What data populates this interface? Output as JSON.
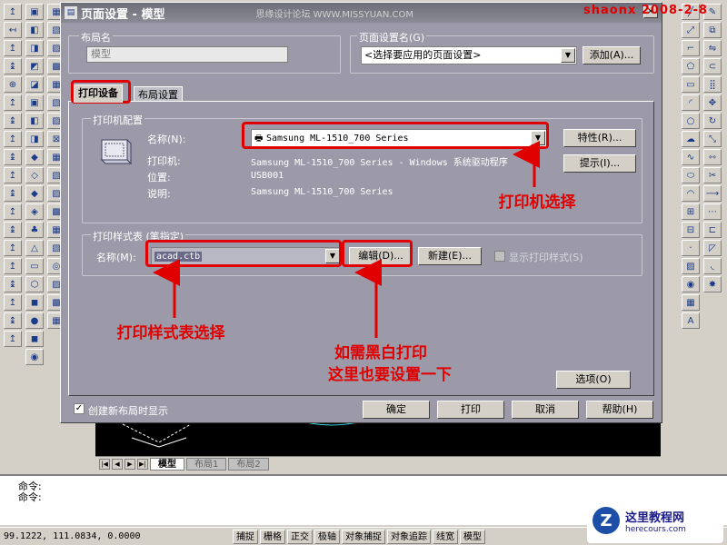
{
  "dialog": {
    "title": "页面设置 - 模型",
    "site_watermark": "思缘设计论坛 WWW.MISSYUAN.COM",
    "close_glyph": "×"
  },
  "stamp": "shaonx 2008-2-8",
  "layout_name": {
    "label": "布局名",
    "value": "模型"
  },
  "page_setup_name": {
    "label": "页面设置名(G)",
    "value": "<选择要应用的页面设置>",
    "add_button": "添加(A)..."
  },
  "tabs": [
    {
      "label": "打印设备"
    },
    {
      "label": "布局设置"
    }
  ],
  "printer_config": {
    "group_label": "打印机配置",
    "name_label": "名称(N):",
    "name_value": "Samsung ML-1510_700 Series",
    "properties_button": "特性(R)...",
    "hints_button": "提示(I)...",
    "printer_label": "打印机:",
    "printer_value": "Samsung ML-1510_700 Series - Windows 系统驱动程序",
    "location_label": "位置:",
    "location_value": "USB001",
    "description_label": "说明:",
    "description_value": "Samsung ML-1510_700 Series"
  },
  "plot_style": {
    "group_label": "打印样式表 (笔指定)",
    "name_label": "名称(M):",
    "name_value": "acad.ctb",
    "edit_button": "编辑(D)...",
    "new_button": "新建(E)...",
    "show_styles_label": "显示打印样式(S)"
  },
  "options_button": "选项(O)",
  "create_on_new_layout_label": "创建新布局时显示",
  "footer_buttons": {
    "ok": "确定",
    "plot": "打印",
    "cancel": "取消",
    "help": "帮助(H)"
  },
  "annotations": {
    "printer_select": "打印机选择",
    "plot_style_select": "打印样式表选择",
    "bw_line1": "如需黑白打印",
    "bw_line2": "这里也要设置一下"
  },
  "layout_tabs": [
    "模型",
    "布局1",
    "布局2"
  ],
  "command_lines": [
    "命令:",
    "命令:"
  ],
  "status": {
    "coordinates": "99.1222,  111.0834, 0.0000",
    "buttons": [
      "捕捉",
      "栅格",
      "正交",
      "极轴",
      "对象捕捉",
      "对象追踪",
      "线宽",
      "模型"
    ]
  },
  "logo": {
    "letter": "Z",
    "cn": "这里教程网",
    "en": "herecours.com"
  },
  "colors": {
    "accent_red": "#e00000",
    "dialog_bg": "#9c9aa8"
  }
}
